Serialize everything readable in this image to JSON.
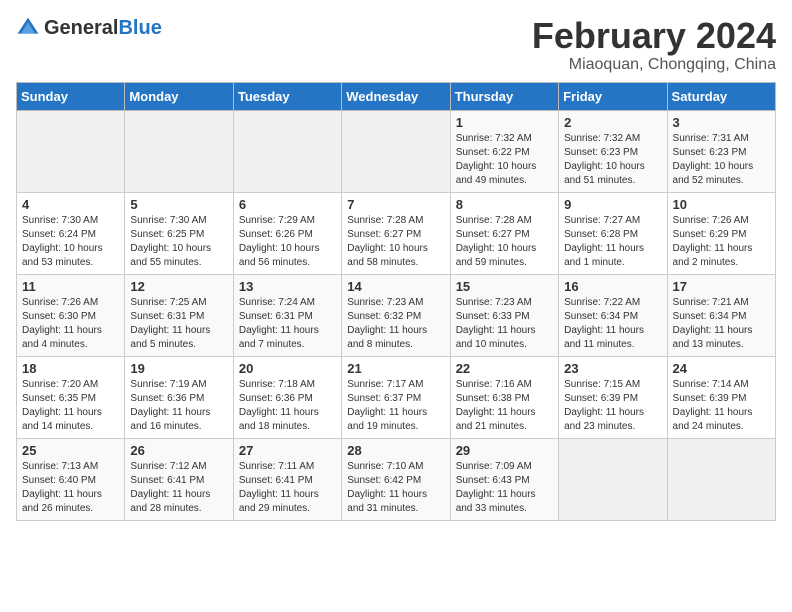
{
  "logo": {
    "general": "General",
    "blue": "Blue"
  },
  "title": "February 2024",
  "subtitle": "Miaoquan, Chongqing, China",
  "weekdays": [
    "Sunday",
    "Monday",
    "Tuesday",
    "Wednesday",
    "Thursday",
    "Friday",
    "Saturday"
  ],
  "weeks": [
    [
      {
        "day": "",
        "empty": true
      },
      {
        "day": "",
        "empty": true
      },
      {
        "day": "",
        "empty": true
      },
      {
        "day": "",
        "empty": true
      },
      {
        "day": "1",
        "sunrise": "7:32 AM",
        "sunset": "6:22 PM",
        "daylight": "10 hours and 49 minutes."
      },
      {
        "day": "2",
        "sunrise": "7:32 AM",
        "sunset": "6:23 PM",
        "daylight": "10 hours and 51 minutes."
      },
      {
        "day": "3",
        "sunrise": "7:31 AM",
        "sunset": "6:23 PM",
        "daylight": "10 hours and 52 minutes."
      }
    ],
    [
      {
        "day": "4",
        "sunrise": "7:30 AM",
        "sunset": "6:24 PM",
        "daylight": "10 hours and 53 minutes."
      },
      {
        "day": "5",
        "sunrise": "7:30 AM",
        "sunset": "6:25 PM",
        "daylight": "10 hours and 55 minutes."
      },
      {
        "day": "6",
        "sunrise": "7:29 AM",
        "sunset": "6:26 PM",
        "daylight": "10 hours and 56 minutes."
      },
      {
        "day": "7",
        "sunrise": "7:28 AM",
        "sunset": "6:27 PM",
        "daylight": "10 hours and 58 minutes."
      },
      {
        "day": "8",
        "sunrise": "7:28 AM",
        "sunset": "6:27 PM",
        "daylight": "10 hours and 59 minutes."
      },
      {
        "day": "9",
        "sunrise": "7:27 AM",
        "sunset": "6:28 PM",
        "daylight": "11 hours and 1 minute."
      },
      {
        "day": "10",
        "sunrise": "7:26 AM",
        "sunset": "6:29 PM",
        "daylight": "11 hours and 2 minutes."
      }
    ],
    [
      {
        "day": "11",
        "sunrise": "7:26 AM",
        "sunset": "6:30 PM",
        "daylight": "11 hours and 4 minutes."
      },
      {
        "day": "12",
        "sunrise": "7:25 AM",
        "sunset": "6:31 PM",
        "daylight": "11 hours and 5 minutes."
      },
      {
        "day": "13",
        "sunrise": "7:24 AM",
        "sunset": "6:31 PM",
        "daylight": "11 hours and 7 minutes."
      },
      {
        "day": "14",
        "sunrise": "7:23 AM",
        "sunset": "6:32 PM",
        "daylight": "11 hours and 8 minutes."
      },
      {
        "day": "15",
        "sunrise": "7:23 AM",
        "sunset": "6:33 PM",
        "daylight": "11 hours and 10 minutes."
      },
      {
        "day": "16",
        "sunrise": "7:22 AM",
        "sunset": "6:34 PM",
        "daylight": "11 hours and 11 minutes."
      },
      {
        "day": "17",
        "sunrise": "7:21 AM",
        "sunset": "6:34 PM",
        "daylight": "11 hours and 13 minutes."
      }
    ],
    [
      {
        "day": "18",
        "sunrise": "7:20 AM",
        "sunset": "6:35 PM",
        "daylight": "11 hours and 14 minutes."
      },
      {
        "day": "19",
        "sunrise": "7:19 AM",
        "sunset": "6:36 PM",
        "daylight": "11 hours and 16 minutes."
      },
      {
        "day": "20",
        "sunrise": "7:18 AM",
        "sunset": "6:36 PM",
        "daylight": "11 hours and 18 minutes."
      },
      {
        "day": "21",
        "sunrise": "7:17 AM",
        "sunset": "6:37 PM",
        "daylight": "11 hours and 19 minutes."
      },
      {
        "day": "22",
        "sunrise": "7:16 AM",
        "sunset": "6:38 PM",
        "daylight": "11 hours and 21 minutes."
      },
      {
        "day": "23",
        "sunrise": "7:15 AM",
        "sunset": "6:39 PM",
        "daylight": "11 hours and 23 minutes."
      },
      {
        "day": "24",
        "sunrise": "7:14 AM",
        "sunset": "6:39 PM",
        "daylight": "11 hours and 24 minutes."
      }
    ],
    [
      {
        "day": "25",
        "sunrise": "7:13 AM",
        "sunset": "6:40 PM",
        "daylight": "11 hours and 26 minutes."
      },
      {
        "day": "26",
        "sunrise": "7:12 AM",
        "sunset": "6:41 PM",
        "daylight": "11 hours and 28 minutes."
      },
      {
        "day": "27",
        "sunrise": "7:11 AM",
        "sunset": "6:41 PM",
        "daylight": "11 hours and 29 minutes."
      },
      {
        "day": "28",
        "sunrise": "7:10 AM",
        "sunset": "6:42 PM",
        "daylight": "11 hours and 31 minutes."
      },
      {
        "day": "29",
        "sunrise": "7:09 AM",
        "sunset": "6:43 PM",
        "daylight": "11 hours and 33 minutes."
      },
      {
        "day": "",
        "empty": true
      },
      {
        "day": "",
        "empty": true
      }
    ]
  ]
}
